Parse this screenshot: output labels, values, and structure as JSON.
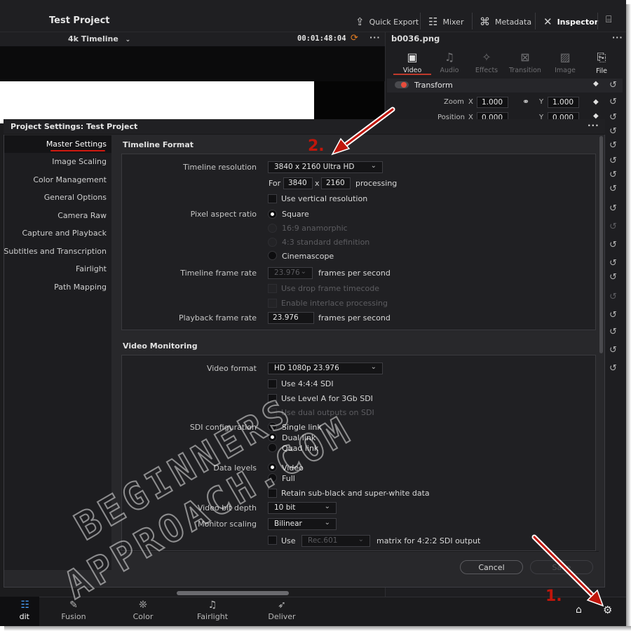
{
  "header": {
    "project_title": "Test Project",
    "tools": [
      {
        "label": "Quick Export",
        "icon": "export-icon"
      },
      {
        "label": "Mixer",
        "icon": "mixer-icon"
      },
      {
        "label": "Metadata",
        "icon": "metadata-icon"
      },
      {
        "label": "Inspector",
        "icon": "inspector-icon",
        "active": true
      }
    ]
  },
  "timeline": {
    "name": "4k Timeline",
    "timecode": "00:01:48:04"
  },
  "inspector": {
    "file_name": "b0036.png",
    "tabs": [
      "Video",
      "Audio",
      "Effects",
      "Transition",
      "Image",
      "File"
    ],
    "active_tab": "Video",
    "section": "Transform",
    "zoom_label": "Zoom",
    "zoom_x": "1.000",
    "zoom_y": "1.000",
    "position_label": "Position",
    "position_x": "0.000",
    "position_y": "0.000",
    "axis_x": "X",
    "axis_y": "Y"
  },
  "dialog": {
    "title": "Project Settings:  Test Project",
    "sidebar": [
      "Master Settings",
      "Image Scaling",
      "Color Management",
      "General Options",
      "Camera Raw",
      "Capture and Playback",
      "Subtitles and Transcription",
      "Fairlight",
      "Path Mapping"
    ],
    "selected": "Master Settings",
    "timeline_format": {
      "title": "Timeline Format",
      "resolution_label": "Timeline resolution",
      "resolution_value": "3840 x 2160 Ultra HD",
      "for_label": "For",
      "width": "3840",
      "x_label": "x",
      "height": "2160",
      "processing_label": "processing",
      "vertical_label": "Use vertical resolution",
      "par_label": "Pixel aspect ratio",
      "par_options": [
        "Square",
        "16:9 anamorphic",
        "4:3 standard definition",
        "Cinemascope"
      ],
      "frame_rate_label": "Timeline frame rate",
      "frame_rate_value": "23.976",
      "fps_label": "frames per second",
      "drop_frame_label": "Use drop frame timecode",
      "interlace_label": "Enable interlace processing",
      "playback_label": "Playback frame rate",
      "playback_value": "23.976",
      "playback_fps_label": "frames per second"
    },
    "video_monitoring": {
      "title": "Video Monitoring",
      "format_label": "Video format",
      "format_value": "HD 1080p 23.976",
      "use444_label": "Use 4:4:4 SDI",
      "levelA_label": "Use Level A for 3Gb SDI",
      "dual_outputs_label": "Use dual outputs on SDI",
      "sdi_label": "SDI configuration",
      "sdi_options": [
        "Single link",
        "Dual link",
        "Quad link"
      ],
      "data_levels_label": "Data levels",
      "data_levels_options": [
        "Video",
        "Full"
      ],
      "retain_label": "Retain sub-black and super-white data",
      "bit_depth_label": "Video bit depth",
      "bit_depth_value": "10 bit",
      "scaling_label": "Monitor scaling",
      "scaling_value": "Bilinear",
      "use_label": "Use",
      "matrix_value": "Rec.601",
      "matrix_label": "matrix for 4:2:2 SDI output"
    },
    "cancel_label": "Cancel",
    "save_label": "Save"
  },
  "bottom_nav": [
    {
      "label": "dit",
      "icon": "edit-icon"
    },
    {
      "label": "Fusion",
      "icon": "fusion-icon"
    },
    {
      "label": "Color",
      "icon": "color-icon"
    },
    {
      "label": "Fairlight",
      "icon": "fairlight-icon"
    },
    {
      "label": "Deliver",
      "icon": "deliver-icon"
    }
  ],
  "annotations": {
    "step1": "1.",
    "step2": "2.",
    "watermark_line1": "BEGINNERS",
    "watermark_line2": "APPROACH.COM"
  }
}
